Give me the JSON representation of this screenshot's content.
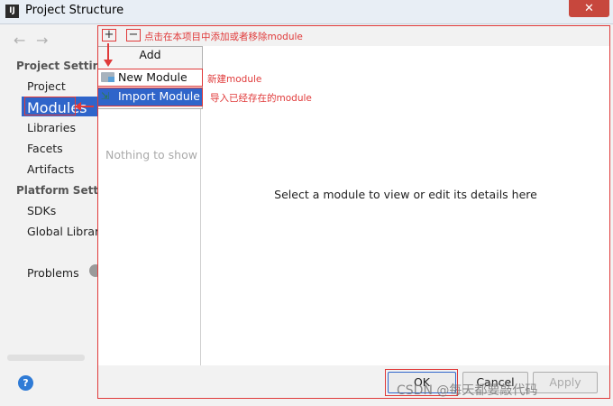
{
  "window": {
    "title": "Project Structure",
    "app_icon_text": "IJ",
    "close_symbol": "✕"
  },
  "nav": {
    "back_symbol": "←",
    "forward_symbol": "→",
    "project_settings_heading": "Project Setting",
    "project_settings_items": [
      "Project",
      "Modules",
      "Libraries",
      "Facets",
      "Artifacts"
    ],
    "platform_settings_heading": "Platform Settin",
    "platform_settings_items": [
      "SDKs",
      "Global Librari"
    ],
    "problems_label": "Problems",
    "selected_item": "Modules",
    "help_symbol": "?"
  },
  "toolbar": {
    "add_symbol": "+",
    "remove_symbol": "−",
    "annotation": "点击在本项目中添加或者移除module"
  },
  "add_popup": {
    "title": "Add",
    "items": [
      {
        "label": "New Module",
        "icon": "folder-icon",
        "annotation": "新建module"
      },
      {
        "label": "Import Module",
        "icon": "import-module-icon",
        "annotation": "导入已经存在的module"
      }
    ]
  },
  "module_list": {
    "empty_text": "Nothing to show"
  },
  "details": {
    "empty_text": "Select a module to view or edit its details here"
  },
  "buttons": {
    "ok": "OK",
    "cancel": "Cancel",
    "apply": "Apply"
  },
  "watermark": "CSDN @每天都要敲代码",
  "colors": {
    "selection": "#2f65ca",
    "annotation_red": "#e03a3a",
    "close_button": "#c7473d"
  }
}
